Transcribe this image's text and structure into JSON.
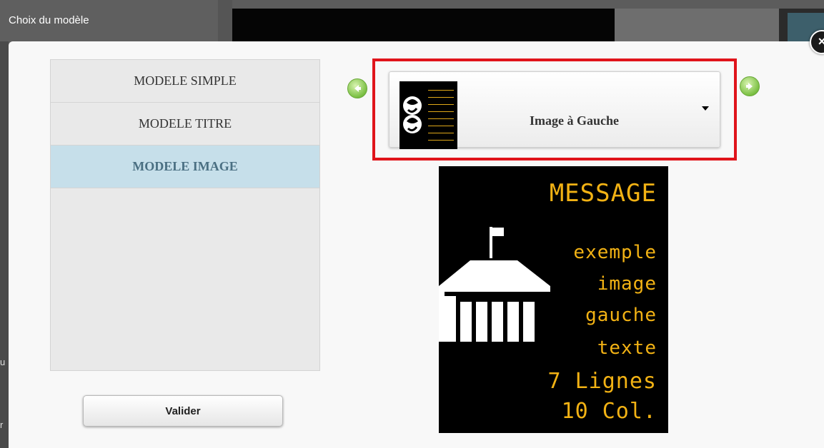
{
  "background": {
    "title": "Choix du modèle",
    "edge_chars": [
      "u",
      "r"
    ]
  },
  "dialog": {
    "close_label": "×",
    "models": [
      {
        "label": "MODELE SIMPLE",
        "active": false
      },
      {
        "label": "MODELE TITRE",
        "active": false
      },
      {
        "label": "MODELE IMAGE",
        "active": true
      }
    ],
    "validate_label": "Valider",
    "selector": {
      "selected": "Image à Gauche"
    },
    "preview": {
      "title": "MESSAGE",
      "lines": [
        "exemple",
        "image",
        "gauche",
        "texte",
        "7 Lignes",
        "10 Col."
      ],
      "text_color": "#f2b214"
    },
    "colors": {
      "highlight": "#e0141b",
      "active_item_bg": "#c6dfea",
      "arrow_green": "#7bc043"
    }
  }
}
